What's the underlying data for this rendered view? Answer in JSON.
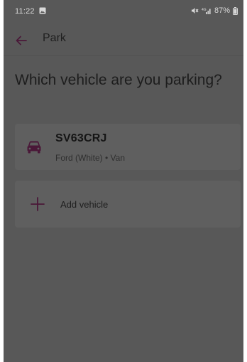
{
  "status_bar": {
    "time": "11:22",
    "battery": "87%",
    "network": "4G"
  },
  "app_bar": {
    "title": "Park"
  },
  "main": {
    "heading": "Which vehicle are you parking?",
    "vehicle": {
      "registration": "SV63CRJ",
      "description": "Ford (White) • Van",
      "icon": "car-icon"
    },
    "add_vehicle": {
      "label": "Add vehicle",
      "icon": "plus-icon"
    }
  },
  "colors": {
    "accent": "#4a1838",
    "overlay_background": "#585858",
    "card_background": "#5f5f5f"
  }
}
